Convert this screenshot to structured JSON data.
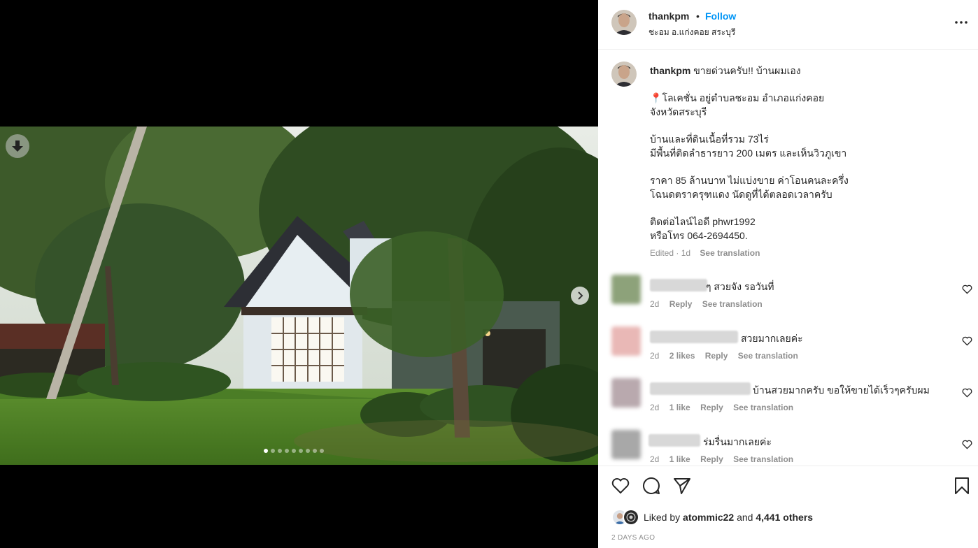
{
  "post": {
    "username": "thankpm",
    "separator": "•",
    "follow_label": "Follow",
    "location": "ชะอม อ.แก่งคอย สระบุรี",
    "more_icon": "more-horizontal-icon"
  },
  "media": {
    "download_icon": "arrow-down-icon",
    "next_icon": "chevron-right-icon",
    "carousel_count": 9,
    "carousel_active_index": 0
  },
  "caption": {
    "username": "thankpm",
    "first_line": "ขายด่วนครับ!! บ้านผมเอง",
    "pin": "📍",
    "lines_block1": [
      "โลเคชั่น อยู่ตำบลชะอม อำเภอแก่งคอย",
      "จังหวัดสระบุรี"
    ],
    "lines_block2": [
      "บ้านและที่ดินเนื้อที่รวม 73ไร่",
      "มีพื้นที่ติดลำธารยาว 200 เมตร และเห็นวิวภูเขา"
    ],
    "lines_block3": [
      "ราคา 85 ล้านบาท ไม่แบ่งขาย ค่าโอนคนละครึ่ง",
      "โฉนดตราครุฑแดง นัดดูที่ได้ตลอดเวลาครับ"
    ],
    "lines_block4": [
      "ติดต่อไลน์ไอดี phwr1992",
      "หรือโทร 064-2694450."
    ],
    "edited": "Edited · 1d",
    "see_translation": "See translation"
  },
  "comments": [
    {
      "text": "ๆ สวยจัง รอวันที่",
      "time": "2d",
      "likes": "",
      "reply": "Reply",
      "translate": "See translation"
    },
    {
      "text": "สวยมากเลยค่ะ",
      "time": "2d",
      "likes": "2 likes",
      "reply": "Reply",
      "translate": "See translation"
    },
    {
      "text": "บ้านสวยมากครับ ขอให้ขายได้เร็วๆครับผม",
      "time": "2d",
      "likes": "1 like",
      "reply": "Reply",
      "translate": "See translation"
    },
    {
      "text": "ร่มรื่นมากเลยค่ะ",
      "time": "2d",
      "likes": "1 like",
      "reply": "Reply",
      "translate": "See translation"
    }
  ],
  "actions": {
    "like_icon": "heart-icon",
    "comment_icon": "comment-icon",
    "share_icon": "send-icon",
    "save_icon": "bookmark-icon",
    "liked_by_prefix": "Liked by",
    "liked_by_user": "atommic22",
    "and_word": "and",
    "others": "4,441 others",
    "time_ago": "2 DAYS AGO"
  },
  "colors": {
    "follow_blue": "#0095f6",
    "meta_gray": "#8e8e8e",
    "media_background": "#000000"
  }
}
